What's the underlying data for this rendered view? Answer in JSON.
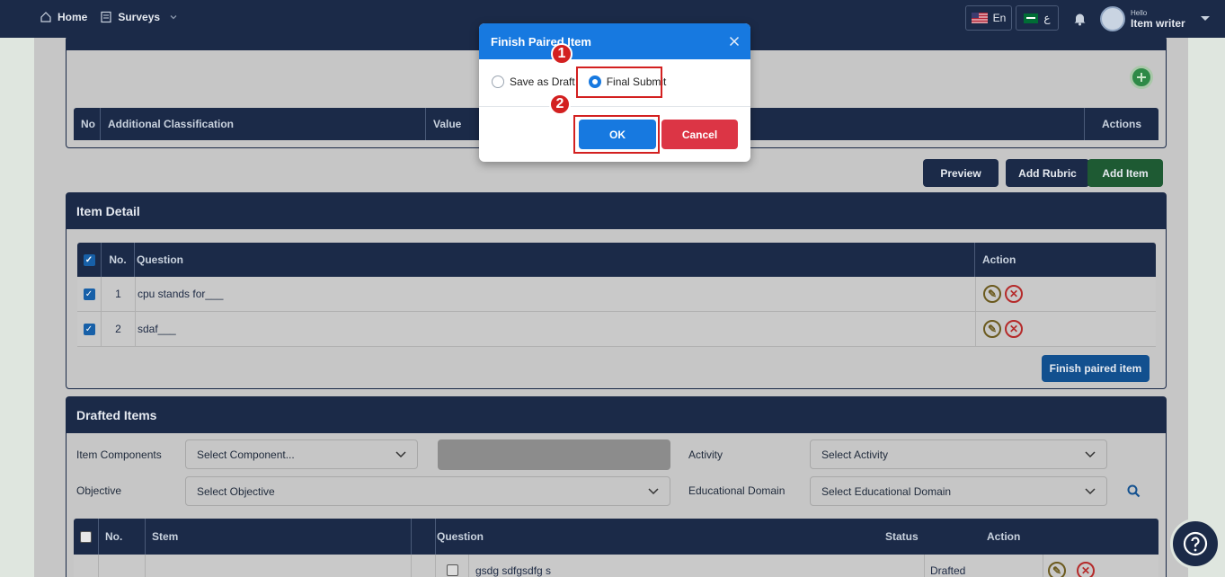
{
  "nav": {
    "home": "Home",
    "surveys": "Surveys"
  },
  "lang": {
    "en": "En",
    "ar": "ع"
  },
  "user": {
    "greeting": "Hello",
    "name": "Item writer"
  },
  "classification_table": {
    "columns": [
      "No",
      "Additional Classification",
      "Value",
      "Actions"
    ]
  },
  "toolbar": {
    "preview": "Preview",
    "add_rubric": "Add Rubric",
    "add_item": "Add Item"
  },
  "item_detail": {
    "title": "Item Detail",
    "columns": [
      "No.",
      "Question",
      "Action"
    ],
    "rows": [
      {
        "no": "1",
        "question": "cpu stands for___"
      },
      {
        "no": "2",
        "question": "sdaf___"
      }
    ],
    "finish_button": "Finish paired item"
  },
  "drafted": {
    "title": "Drafted Items",
    "filters": {
      "item_components_label": "Item Components",
      "item_components_value": "Select Component...",
      "activity_label": "Activity",
      "activity_value": "Select Activity",
      "objective_label": "Objective",
      "objective_value": "Select Objective",
      "domain_label": "Educational Domain",
      "domain_value": "Select Educational Domain"
    },
    "columns": [
      "No.",
      "Stem",
      "Question",
      "Status",
      "Action"
    ],
    "rows": [
      {
        "question": "gsdg sdfgsdfg s",
        "status": "Drafted"
      }
    ]
  },
  "modal": {
    "title": "Finish Paired Item",
    "option_draft": "Save as Draft",
    "option_final": "Final Submit",
    "ok": "OK",
    "cancel": "Cancel",
    "marker1": "1",
    "marker2": "2"
  },
  "colors": {
    "navy": "#1b2a48",
    "modal_blue": "#1779e0",
    "cancel_red": "#dc3545",
    "add_green": "#1e7a3c",
    "highlight_red": "#d32020"
  },
  "icons": {
    "home": "home-icon",
    "surveys": "document-icon",
    "bell": "bell-icon",
    "close": "close-icon",
    "edit": "pencil-icon",
    "delete": "x-circle-icon",
    "search": "search-icon",
    "help": "question-icon",
    "add": "plus-icon"
  }
}
